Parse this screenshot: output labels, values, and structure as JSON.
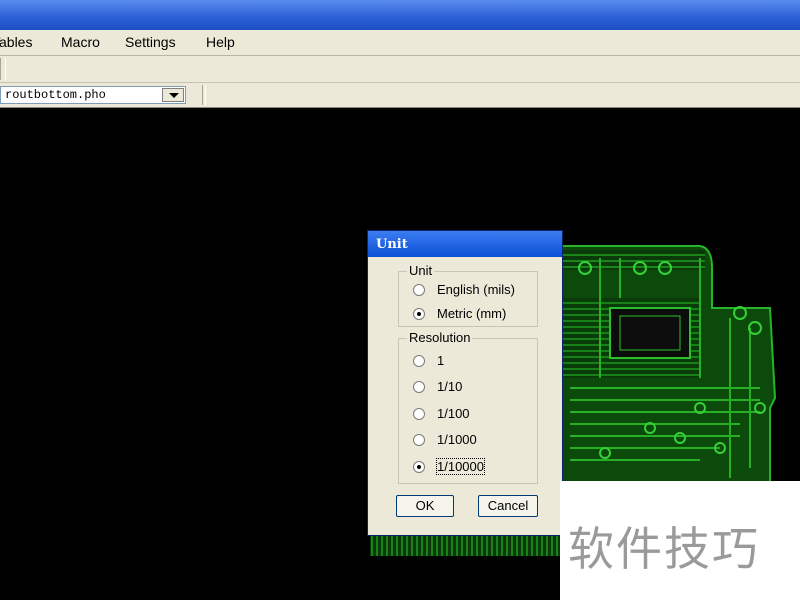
{
  "menubar": {
    "items": [
      "Tables",
      "Macro",
      "Settings",
      "Help"
    ]
  },
  "toolbar": {
    "file_combo_value": "routbottom.pho"
  },
  "dialog": {
    "title": "Unit",
    "unit_group": {
      "label": "Unit",
      "options": [
        {
          "label": "English (mils)",
          "checked": false
        },
        {
          "label": "Metric (mm)",
          "checked": true
        }
      ]
    },
    "resolution_group": {
      "label": "Resolution",
      "options": [
        {
          "label": "1",
          "checked": false
        },
        {
          "label": "1/10",
          "checked": false
        },
        {
          "label": "1/100",
          "checked": false
        },
        {
          "label": "1/1000",
          "checked": false
        },
        {
          "label": "1/10000",
          "checked": true
        }
      ]
    },
    "ok_label": "OK",
    "cancel_label": "Cancel"
  },
  "watermark": {
    "text": "软件技巧"
  },
  "colors": {
    "titlebar": "#2a5fd6",
    "pcb_copper": "#1e8a1e",
    "canvas_background": "#000000"
  }
}
